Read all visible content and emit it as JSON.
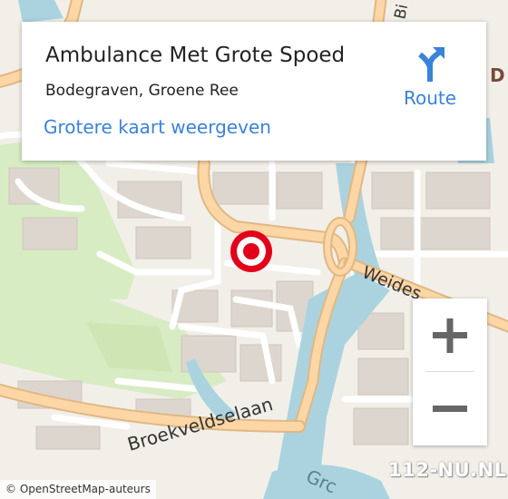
{
  "map": {
    "streets": {
      "weidestraat": "Weides",
      "broekveldselaan": "Broekveldselaan",
      "groene_ree": "Grc",
      "edge_label_top": "Bi",
      "edge_label_right": "D"
    },
    "colors": {
      "land": "#f2efe9",
      "water": "#aad3df",
      "major_road": "#fcd6a4",
      "minor_road": "#ffffff",
      "building": "#d9d0c9",
      "park": "#cdebb0",
      "marker": "#e3001b"
    }
  },
  "info_card": {
    "title": "Ambulance Met Grote Spoed",
    "subtitle": "Bodegraven, Groene Ree",
    "link": "Grotere kaart weergeven"
  },
  "route": {
    "label": "Route",
    "icon": "route-arrow-icon"
  },
  "zoom": {
    "in_icon": "plus-icon",
    "out_icon": "minus-icon"
  },
  "attribution": "© OpenStreetMap-auteurs",
  "watermark": "112-NU.NL"
}
